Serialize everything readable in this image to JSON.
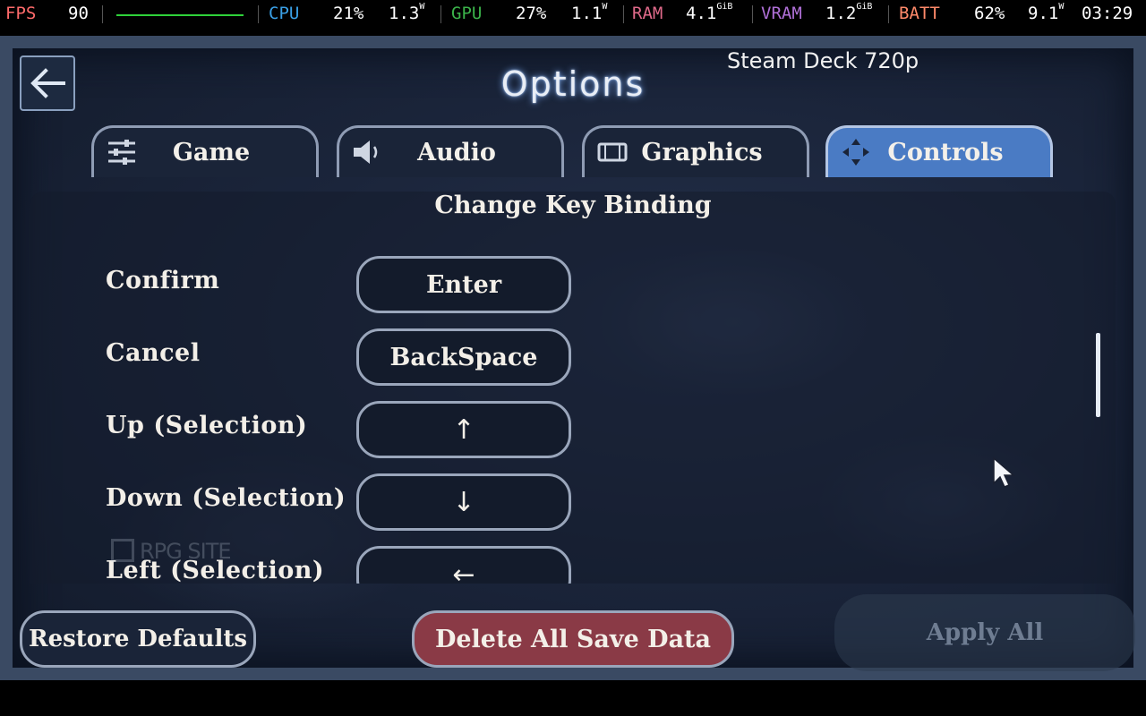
{
  "overlay": {
    "fps_label": "FPS",
    "fps_value": "90",
    "cpu_label": "CPU",
    "cpu_load": "21%",
    "cpu_power": "1.3",
    "cpu_power_unit": "W",
    "gpu_label": "GPU",
    "gpu_load": "27%",
    "gpu_power": "1.1",
    "gpu_power_unit": "W",
    "ram_label": "RAM",
    "ram_value": "4.1",
    "ram_unit": "GiB",
    "vram_label": "VRAM",
    "vram_value": "1.2",
    "vram_unit": "GiB",
    "batt_label": "BATT",
    "batt_percent": "62%",
    "batt_power": "9.1",
    "batt_power_unit": "W",
    "clock": "03:29",
    "colors": {
      "fps": "#ff6b6b",
      "cpu": "#3aa0e6",
      "gpu": "#3bb34a",
      "ram": "#e06a8a",
      "vram": "#b070d8",
      "batt": "#ff8a6a"
    }
  },
  "header": {
    "title": "Options",
    "preset_label": "Steam Deck 720p",
    "back_icon": "arrow-left-icon"
  },
  "tabs": [
    {
      "label": "Game",
      "icon": "sliders-icon",
      "active": false
    },
    {
      "label": "Audio",
      "icon": "speaker-icon",
      "active": false
    },
    {
      "label": "Graphics",
      "icon": "display-icon",
      "active": false
    },
    {
      "label": "Controls",
      "icon": "dpad-icon",
      "active": true
    }
  ],
  "panel": {
    "section_title": "Change Key Binding",
    "bindings": [
      {
        "action": "Confirm",
        "key": "Enter"
      },
      {
        "action": "Cancel",
        "key": "BackSpace"
      },
      {
        "action": "Up (Selection)",
        "key": "↑"
      },
      {
        "action": "Down (Selection)",
        "key": "↓"
      },
      {
        "action": "Left (Selection)",
        "key": "←"
      }
    ]
  },
  "watermark": "RPG SITE",
  "buttons": {
    "restore_defaults": "Restore Defaults",
    "delete_all": "Delete All Save Data",
    "apply_all": "Apply All"
  }
}
